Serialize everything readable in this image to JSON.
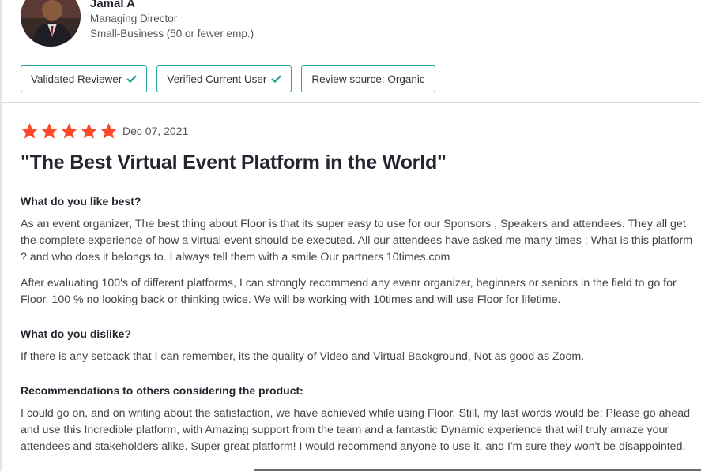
{
  "reviewer": {
    "name": "Jamal A",
    "role": "Managing Director",
    "company_size": "Small-Business (50 or fewer emp.)"
  },
  "badges": [
    {
      "label": "Validated Reviewer",
      "check": true
    },
    {
      "label": "Verified Current User",
      "check": true
    },
    {
      "label": "Review source: Organic",
      "check": false
    }
  ],
  "colors": {
    "star": "#ff492c",
    "badge_border": "#27a499",
    "check": "#27a499"
  },
  "review": {
    "rating": 5,
    "date": "Dec 07, 2021",
    "title": "\"The Best Virtual Event Platform in the World\"",
    "like_question": "What do you like best?",
    "like_answer_1": "As an event organizer, The best thing about Floor is that its super easy to use for our Sponsors , Speakers and attendees. They all get the complete experience of how a virtual event should be executed. All our attendees have asked me many times : What is this platform ? and who does it belongs to. I always tell them with a smile Our partners 10times.com",
    "like_answer_2": "After evaluating 100's of different platforms, I can strongly recommend any evenr organizer, beginners or seniors in the field to go for Floor. 100 % no looking back or thinking twice. We will be working with 10times and will use Floor for lifetime.",
    "dislike_question": "What do you dislike?",
    "dislike_answer": "If there is any setback that I can remember, its the quality of Video and Virtual Background, Not as good as Zoom.",
    "recommend_question": "Recommendations to others considering the product:",
    "recommend_answer": "I could go on, and on writing about the satisfaction, we have achieved while using Floor. Still, my last words would be: Please go ahead and use this Incredible platform, with Amazing support from the team and a fantastic Dynamic experience that will truly amaze your attendees and stakeholders alike. Super great platform! I would recommend anyone to use it, and I'm sure they won't be disappointed."
  }
}
